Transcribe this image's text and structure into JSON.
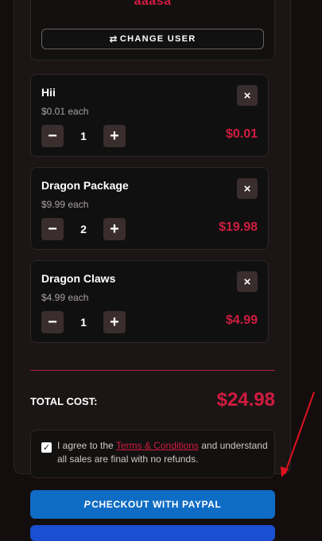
{
  "user": {
    "username": "aaasa",
    "change_user_label": "CHANGE USER",
    "change_user_icon": "swap-arrows-icon"
  },
  "cart": {
    "items": [
      {
        "name": "Hii",
        "price_each": "$0.01 each",
        "quantity": "1",
        "total": "$0.01"
      },
      {
        "name": "Dragon Package",
        "price_each": "$9.99 each",
        "quantity": "2",
        "total": "$19.98"
      },
      {
        "name": "Dragon Claws",
        "price_each": "$4.99 each",
        "quantity": "1",
        "total": "$4.99"
      }
    ],
    "remove_icon": "×",
    "minus_icon": "−",
    "plus_icon": "+"
  },
  "summary": {
    "total_label": "TOTAL COST:",
    "total_value": "$24.98"
  },
  "terms": {
    "checked": true,
    "text_before": "I agree to the ",
    "link_text": "Terms & Conditions",
    "text_after": " and understand all sales are final with no refunds."
  },
  "checkout": {
    "paypal_label": "CHECKOUT WITH PAYPAL",
    "paypal_icon": "P"
  },
  "colors": {
    "accent": "#d01c40",
    "paypal": "#0f6cc4",
    "arrow": "#e0121f"
  }
}
